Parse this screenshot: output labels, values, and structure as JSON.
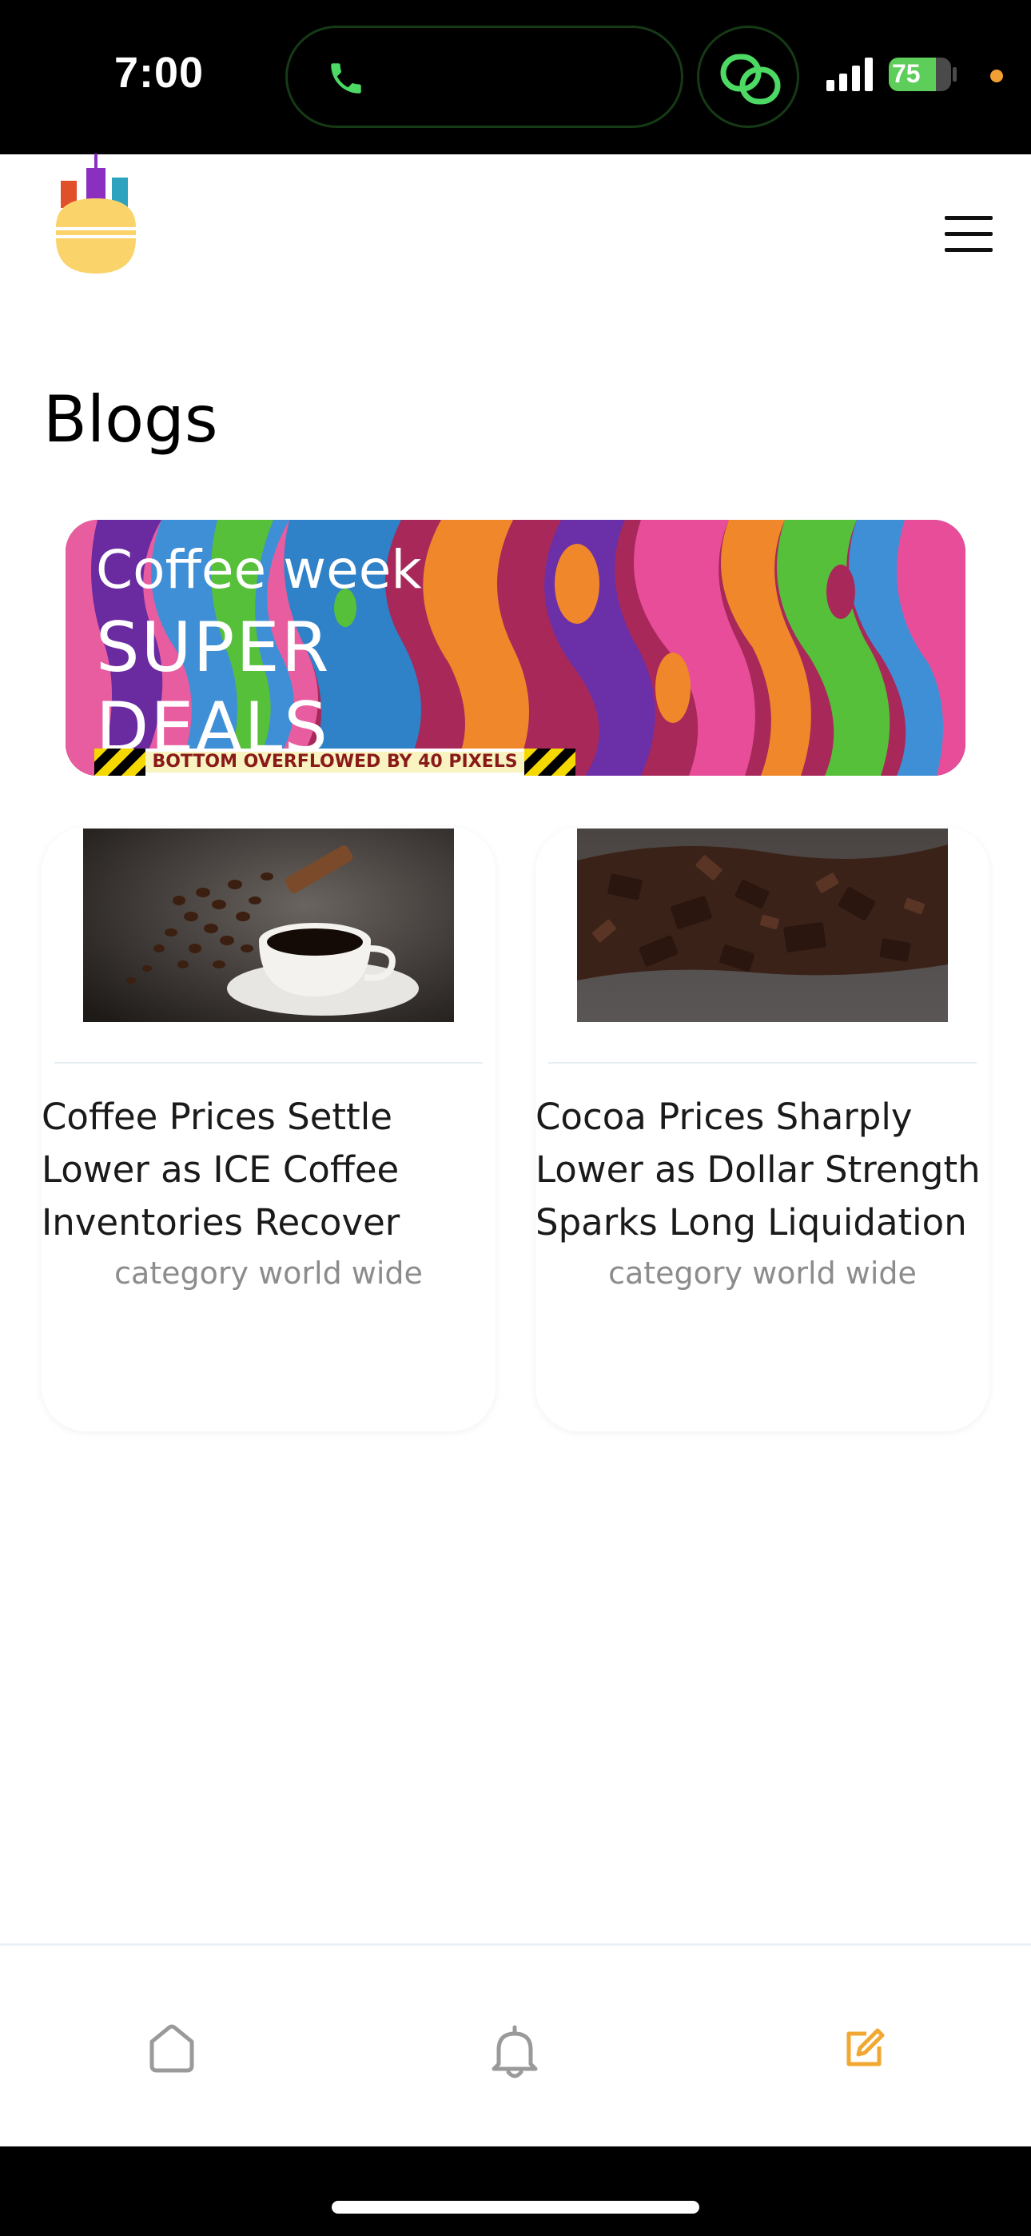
{
  "status_bar": {
    "time": "7:00",
    "battery": "75",
    "battery_level": 0.75
  },
  "header": {
    "logo_icon": "candlestick-burger-logo",
    "menu_icon": "hamburger-menu-icon"
  },
  "page": {
    "title": "Blogs"
  },
  "banner": {
    "line1": "Coffee week",
    "line2": "SUPER",
    "line3": "DEALS",
    "overflow_warning": "BOTTOM OVERFLOWED BY 40 PIXELS"
  },
  "posts": [
    {
      "title": "Coffee Prices Settle Lower as ICE Coffee Inventories Recover",
      "category": "category world wide",
      "image": "coffee-cup-beans"
    },
    {
      "title": "Cocoa Prices Sharply Lower as Dollar Strength Sparks Long Liquidation",
      "category": "category world wide",
      "image": "chocolate-pieces"
    }
  ],
  "bottom_nav": {
    "items": [
      {
        "name": "home",
        "icon": "home-icon",
        "active": false
      },
      {
        "name": "notifications",
        "icon": "bell-icon",
        "active": false
      },
      {
        "name": "blogs",
        "icon": "edit-icon",
        "active": true
      }
    ]
  },
  "colors": {
    "accent": "#f0a832",
    "inactive_icon": "#9a9a9a",
    "category_text": "#8c8c8c"
  }
}
